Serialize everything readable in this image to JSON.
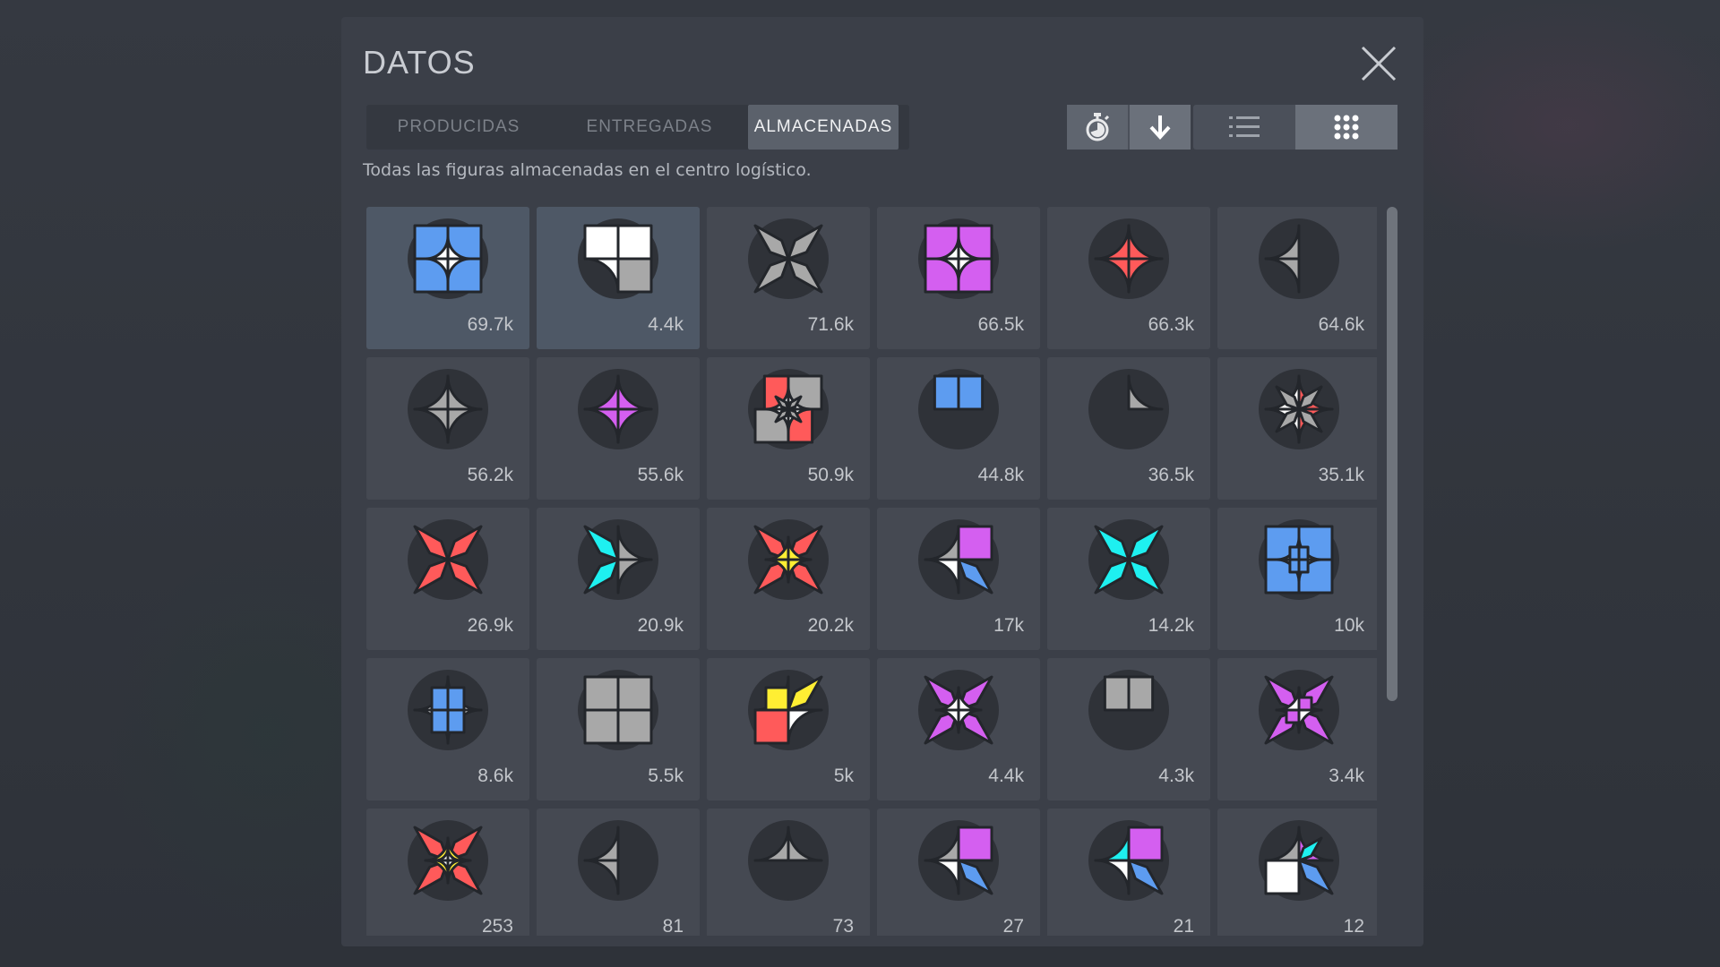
{
  "modal": {
    "title": "DATOS",
    "subtitle": "Todas las figuras almacenadas en el centro logístico."
  },
  "tabs": [
    {
      "label": "PRODUCIDAS",
      "active": false
    },
    {
      "label": "ENTREGADAS",
      "active": false
    },
    {
      "label": "ALMACENADAS",
      "active": true
    }
  ],
  "toolbar": {
    "icons": [
      "stopwatch-icon",
      "arrow-down-icon",
      "list-view-icon",
      "grid-view-icon"
    ],
    "active": [
      "stopwatch-icon",
      "arrow-down-icon",
      "grid-view-icon"
    ]
  },
  "colors": {
    "red": "#ff5a5a",
    "green": "#6cf25f",
    "blue": "#5d9cf0",
    "yellow": "#ffee33",
    "purple": "#d45ff0",
    "cyan": "#1ef0f0",
    "white": "#ffffff",
    "gray": "#a8a8a8",
    "selected_cell": "#4e5866"
  },
  "shapes": [
    {
      "count": "69.7k",
      "selected": true,
      "layers": [
        [
          [
            "S",
            "b"
          ],
          [
            "S",
            "b"
          ],
          [
            "S",
            "b"
          ],
          [
            "S",
            "b"
          ]
        ],
        [
          [
            "C",
            "w"
          ],
          [
            "C",
            "w"
          ],
          [
            "C",
            "w"
          ],
          [
            "C",
            "w"
          ]
        ]
      ]
    },
    {
      "count": "4.4k",
      "selected": true,
      "layers": [
        [
          [
            "S",
            "w"
          ],
          [
            "S",
            "g"
          ],
          [
            "C",
            "w"
          ],
          [
            "S",
            "w"
          ]
        ]
      ]
    },
    {
      "count": "71.6k",
      "selected": false,
      "layers": [
        [
          [
            "W",
            "g"
          ],
          [
            "W",
            "g"
          ],
          [
            "W",
            "g"
          ],
          [
            "W",
            "g"
          ]
        ]
      ]
    },
    {
      "count": "66.5k",
      "selected": false,
      "layers": [
        [
          [
            "S",
            "p"
          ],
          [
            "S",
            "p"
          ],
          [
            "S",
            "p"
          ],
          [
            "S",
            "p"
          ]
        ],
        [
          [
            "C",
            "w"
          ],
          [
            "C",
            "w"
          ],
          [
            "C",
            "w"
          ],
          [
            "C",
            "w"
          ]
        ]
      ]
    },
    {
      "count": "66.3k",
      "selected": false,
      "layers": [
        [
          [
            "C",
            "r"
          ],
          [
            "C",
            "r"
          ],
          [
            "C",
            "r"
          ],
          [
            "C",
            "r"
          ]
        ]
      ]
    },
    {
      "count": "64.6k",
      "selected": false,
      "layers": [
        [
          null,
          null,
          [
            "C",
            "g"
          ],
          [
            "C",
            "g"
          ]
        ]
      ]
    },
    {
      "count": "56.2k",
      "selected": false,
      "layers": [
        [
          [
            "C",
            "g"
          ],
          [
            "C",
            "g"
          ],
          [
            "C",
            "g"
          ],
          [
            "C",
            "g"
          ]
        ]
      ]
    },
    {
      "count": "55.6k",
      "selected": false,
      "layers": [
        [
          [
            "C",
            "p"
          ],
          [
            "C",
            "p"
          ],
          [
            "C",
            "p"
          ],
          [
            "C",
            "p"
          ]
        ]
      ]
    },
    {
      "count": "50.9k",
      "selected": false,
      "layers": [
        [
          [
            "S",
            "g"
          ],
          [
            "R",
            "r"
          ],
          [
            "S",
            "g"
          ],
          [
            "R",
            "r"
          ]
        ],
        [
          [
            "C",
            "w"
          ],
          [
            "C",
            "w"
          ],
          [
            "C",
            "w"
          ],
          [
            "C",
            "w"
          ]
        ],
        [
          [
            "W",
            "g"
          ],
          [
            "W",
            "g"
          ],
          [
            "W",
            "g"
          ],
          [
            "W",
            "g"
          ]
        ]
      ]
    },
    {
      "count": "44.8k",
      "selected": false,
      "layers": [
        [
          [
            "R",
            "b"
          ],
          null,
          null,
          [
            "R",
            "b"
          ]
        ]
      ]
    },
    {
      "count": "36.5k",
      "selected": false,
      "layers": [
        [
          [
            "C",
            "g"
          ],
          null,
          null,
          null
        ]
      ]
    },
    {
      "count": "35.1k",
      "selected": false,
      "layers": [
        [
          [
            "C",
            "r"
          ],
          [
            "C",
            "r"
          ],
          [
            "C",
            "w"
          ],
          [
            "C",
            "w"
          ]
        ],
        [
          [
            "W",
            "g"
          ],
          [
            "W",
            "g"
          ],
          [
            "W",
            "g"
          ],
          [
            "W",
            "g"
          ]
        ]
      ]
    },
    {
      "count": "26.9k",
      "selected": false,
      "layers": [
        [
          [
            "W",
            "r"
          ],
          [
            "W",
            "r"
          ],
          [
            "W",
            "r"
          ],
          [
            "W",
            "r"
          ]
        ]
      ]
    },
    {
      "count": "20.9k",
      "selected": false,
      "layers": [
        [
          [
            "C",
            "g"
          ],
          [
            "C",
            "g"
          ],
          [
            "W",
            "c"
          ],
          [
            "W",
            "c"
          ]
        ]
      ]
    },
    {
      "count": "20.2k",
      "selected": false,
      "layers": [
        [
          [
            "W",
            "r"
          ],
          [
            "W",
            "r"
          ],
          [
            "W",
            "r"
          ],
          [
            "W",
            "r"
          ]
        ],
        [
          [
            "C",
            "y"
          ],
          [
            "C",
            "y"
          ],
          [
            "C",
            "y"
          ],
          [
            "C",
            "y"
          ]
        ]
      ]
    },
    {
      "count": "17k",
      "selected": false,
      "layers": [
        [
          [
            "S",
            "p"
          ],
          [
            "W",
            "b"
          ],
          [
            "C",
            "w"
          ],
          [
            "C",
            "g"
          ]
        ]
      ]
    },
    {
      "count": "14.2k",
      "selected": false,
      "layers": [
        [
          [
            "W",
            "c"
          ],
          [
            "W",
            "c"
          ],
          [
            "W",
            "c"
          ],
          [
            "W",
            "c"
          ]
        ]
      ]
    },
    {
      "count": "10k",
      "selected": false,
      "layers": [
        [
          [
            "S",
            "b"
          ],
          [
            "S",
            "b"
          ],
          [
            "S",
            "b"
          ],
          [
            "S",
            "b"
          ]
        ],
        [
          [
            "C",
            "w"
          ],
          [
            "C",
            "w"
          ],
          [
            "C",
            "w"
          ],
          [
            "C",
            "w"
          ]
        ],
        [
          [
            "R",
            "b"
          ],
          [
            "R",
            "b"
          ],
          [
            "R",
            "b"
          ],
          [
            "R",
            "b"
          ]
        ]
      ]
    },
    {
      "count": "8.6k",
      "selected": false,
      "layers": [
        [
          [
            "C",
            "w"
          ],
          [
            "C",
            "w"
          ],
          [
            "C",
            "w"
          ],
          [
            "C",
            "w"
          ]
        ],
        [
          [
            "R",
            "b"
          ],
          [
            "R",
            "b"
          ],
          [
            "R",
            "b"
          ],
          [
            "R",
            "b"
          ]
        ]
      ]
    },
    {
      "count": "5.5k",
      "selected": false,
      "layers": [
        [
          [
            "S",
            "g"
          ],
          [
            "S",
            "g"
          ],
          [
            "S",
            "g"
          ],
          [
            "S",
            "g"
          ]
        ]
      ]
    },
    {
      "count": "5k",
      "selected": false,
      "layers": [
        [
          [
            "W",
            "y"
          ],
          [
            "C",
            "w"
          ],
          [
            "S",
            "r"
          ],
          [
            "C",
            "c"
          ]
        ],
        [
          null,
          null,
          null,
          [
            "S",
            "y"
          ]
        ]
      ]
    },
    {
      "count": "4.4k",
      "selected": false,
      "layers": [
        [
          [
            "W",
            "p"
          ],
          [
            "W",
            "p"
          ],
          [
            "W",
            "p"
          ],
          [
            "W",
            "p"
          ]
        ],
        [
          [
            "C",
            "w"
          ],
          [
            "C",
            "w"
          ],
          [
            "C",
            "w"
          ],
          [
            "C",
            "w"
          ]
        ]
      ]
    },
    {
      "count": "4.3k",
      "selected": false,
      "layers": [
        [
          [
            "R",
            "g"
          ],
          null,
          null,
          [
            "R",
            "g"
          ]
        ]
      ]
    },
    {
      "count": "3.4k",
      "selected": false,
      "layers": [
        [
          [
            "W",
            "p"
          ],
          [
            "W",
            "p"
          ],
          [
            "W",
            "p"
          ],
          [
            "W",
            "p"
          ]
        ],
        [
          [
            "C",
            "w"
          ],
          [
            "C",
            "w"
          ],
          [
            "C",
            "w"
          ],
          [
            "C",
            "w"
          ]
        ],
        [
          [
            "S",
            "p"
          ],
          null,
          [
            "S",
            "p"
          ],
          null
        ]
      ]
    },
    {
      "count": "253",
      "selected": false,
      "layers": [
        [
          [
            "W",
            "r"
          ],
          [
            "W",
            "r"
          ],
          [
            "W",
            "r"
          ],
          [
            "W",
            "r"
          ]
        ],
        [
          [
            "C",
            "y"
          ],
          [
            "C",
            "y"
          ],
          [
            "C",
            "y"
          ],
          [
            "C",
            "y"
          ]
        ],
        [
          [
            "C",
            "w"
          ],
          [
            "C",
            "w"
          ],
          [
            "C",
            "w"
          ],
          [
            "C",
            "w"
          ]
        ]
      ]
    },
    {
      "count": "81",
      "selected": false,
      "layers": [
        [
          null,
          null,
          [
            "C",
            "g"
          ],
          [
            "C",
            "g"
          ]
        ]
      ]
    },
    {
      "count": "73",
      "selected": false,
      "layers": [
        [
          [
            "C",
            "g"
          ],
          null,
          null,
          [
            "C",
            "g"
          ]
        ]
      ]
    },
    {
      "count": "27",
      "selected": false,
      "layers": [
        [
          [
            "S",
            "p"
          ],
          [
            "W",
            "b"
          ],
          [
            "C",
            "w"
          ],
          [
            "C",
            "g"
          ]
        ]
      ]
    },
    {
      "count": "21",
      "selected": false,
      "layers": [
        [
          [
            "S",
            "p"
          ],
          [
            "W",
            "b"
          ],
          [
            "C",
            "w"
          ],
          [
            "C",
            "c"
          ]
        ]
      ]
    },
    {
      "count": "12",
      "selected": false,
      "layers": [
        [
          [
            "C",
            "p"
          ],
          [
            "W",
            "b"
          ],
          [
            "S",
            "w"
          ],
          [
            "C",
            "g"
          ]
        ],
        [
          [
            "W",
            "c"
          ],
          null,
          null,
          null
        ]
      ]
    }
  ]
}
